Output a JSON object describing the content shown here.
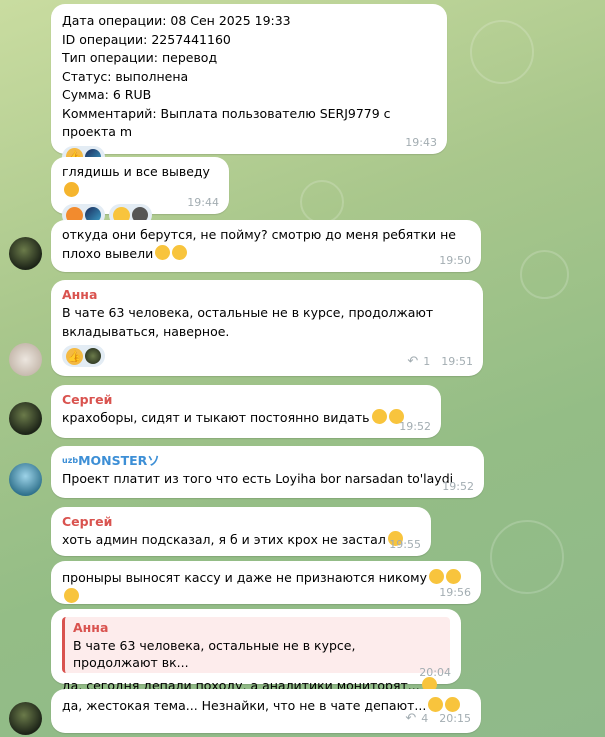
{
  "messages": [
    {
      "lines": [
        "Дата операции: 08 Сен 2025 19:33",
        "ID операции: 2257441160",
        "Тип операции: перевод",
        "Статус: выполнена",
        "Сумма: 6 RUB",
        "Комментарий: Выплата пользователю SERJ9779 с проекта m"
      ],
      "time": "19:43"
    },
    {
      "text": "глядишь и все выведу",
      "time": "19:44"
    },
    {
      "text": "откуда они берутся, не пойму? смотрю до меня ребятки не\nплохо вывели",
      "time": "19:50"
    },
    {
      "sender": "Анна",
      "sender_color": "#d9534f",
      "text": "В чате 63 человека, остальные не в курсе, продолжают\nвкладываться, наверное.",
      "reply_count": "1",
      "time": "19:51"
    },
    {
      "sender": "Сергей",
      "sender_color": "#d9534f",
      "text": "крахоборы, сидят и тыкают постоянно видать",
      "time": "19:52"
    },
    {
      "sender": "MONSTERソ",
      "sender_prefix": "uzb",
      "sender_color": "#3d8fd6",
      "text": "Проект платит из того что есть Loyiha bor narsadan to'laydi",
      "time": "19:52"
    },
    {
      "sender": "Сергей",
      "sender_color": "#d9534f",
      "text": "хоть админ подсказал, я б и этих крох не застал",
      "time": "19:55"
    },
    {
      "text": "проныры выносят кассу и даже не признаются никому",
      "time": "19:56"
    },
    {
      "quote_sender": "Анна",
      "quote_text": "В чате 63 человека, остальные не в курсе, продолжают вк...",
      "text": "да, сегодня депали походу, а аналитики мониторят...",
      "time": "20:04"
    },
    {
      "text": "да, жестокая тема... Незнайки, что не в чате депают...",
      "reply_count": "4",
      "time": "20:15"
    }
  ],
  "icons": {
    "reply": "reply-arrow-icon",
    "thumbs_up": "thumbs-up-icon",
    "fire": "fire-icon",
    "grin": "grin-emoji-icon"
  }
}
